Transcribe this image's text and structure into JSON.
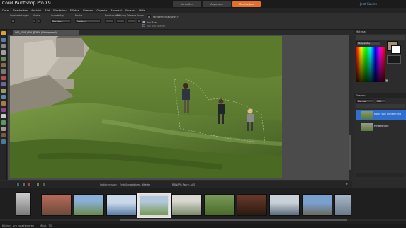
{
  "app": {
    "title": "Corel PaintShop Pro X9",
    "user_link": "Jetzt Kaufen"
  },
  "workspace_tabs": [
    {
      "label": "Verwalten",
      "active": false
    },
    {
      "label": "Anpassen",
      "active": false
    },
    {
      "label": "Bearbeiten",
      "active": true
    }
  ],
  "menu": [
    "Datei",
    "Bearbeiten",
    "Ansicht",
    "Bild",
    "Einstellen",
    "Effekte",
    "Ebenen",
    "Objekte",
    "Auswahl",
    "Fenster",
    "Hilfe"
  ],
  "options": {
    "labels": [
      "Voreinstellungen",
      "Modus",
      "Auswahltyp",
      "Modus",
      "Randschärfe",
      "Glättung",
      "Toleranz",
      "Innen",
      "Farbbereichsauswahl",
      "Anti-Alias",
      "Von Bild ablesen"
    ],
    "selection_type": "Rechteck",
    "mode": "Ersetzen",
    "antialias_checked": true
  },
  "document": {
    "tab_title": "IMG_3748.JPG* @ 38% (Hintergrund)"
  },
  "materials_panel": {
    "title": "Material",
    "palette_name": "Farbpalette"
  },
  "layers_panel": {
    "title": "Ebenen",
    "blend_mode": "Normal",
    "opacity": "100",
    "layers": [
      {
        "name": "Kopie von Hintergrund",
        "selected": true
      },
      {
        "name": "Hintergrund",
        "selected": false
      }
    ]
  },
  "organizer": {
    "label_sort": "Sortieren nach:",
    "label_sort_value": "Erstellungsdatum - älteste",
    "label_filter": "RAW/JPG Paare: AUS",
    "thumbnail_count": 11,
    "selected_index": 3
  },
  "status": {
    "left": "Klicken, um zu aktivieren",
    "right": "Mitgl.: 7/1"
  },
  "colors": {
    "accent": "#e5702a",
    "selection": "#2f6fd0",
    "foreground_swatch": "#a98f78"
  }
}
